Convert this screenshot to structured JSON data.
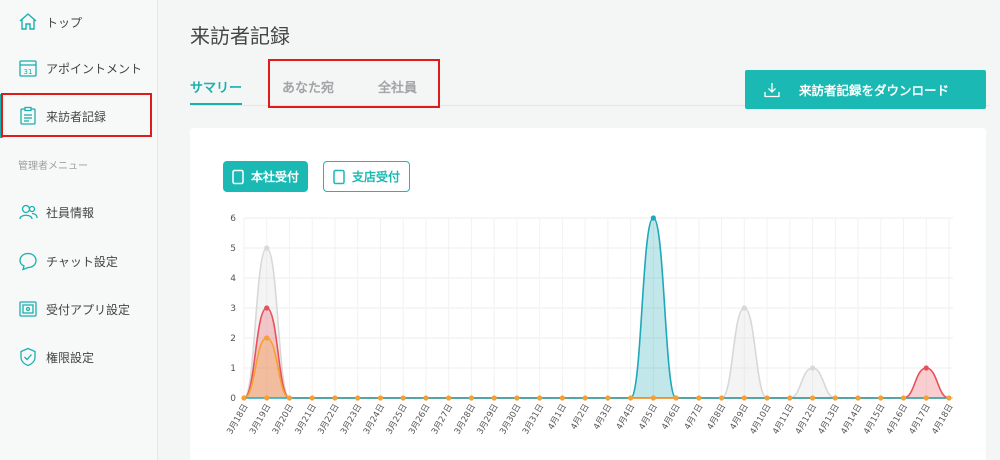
{
  "sidebar": {
    "items": [
      {
        "label": "トップ",
        "icon": "home-icon"
      },
      {
        "label": "アポイントメント",
        "icon": "calendar-icon",
        "icon_text": "31"
      },
      {
        "label": "来訪者記録",
        "icon": "clipboard-icon",
        "active": true
      },
      {
        "label": "社員情報",
        "icon": "users-icon"
      },
      {
        "label": "チャット設定",
        "icon": "chat-bubble-icon"
      },
      {
        "label": "受付アプリ設定",
        "icon": "tablet-icon"
      },
      {
        "label": "権限設定",
        "icon": "shield-check-icon"
      }
    ],
    "section_label": "管理者メニュー"
  },
  "main": {
    "title": "来訪者記録",
    "tabs": [
      {
        "label": "サマリー",
        "active": true
      },
      {
        "label": "あなた宛",
        "active": false
      },
      {
        "label": "全社員",
        "active": false
      }
    ],
    "download_button": {
      "label": "来訪者記録をダウンロード",
      "icon": "download-icon"
    },
    "filters": [
      {
        "label": "本社受付",
        "selected": true,
        "icon": "tablet-icon"
      },
      {
        "label": "支店受付",
        "selected": false,
        "icon": "tablet-icon"
      }
    ]
  },
  "colors": {
    "accent": "#1ab9b3",
    "highlight": "#e01b1b"
  },
  "chart_data": {
    "type": "area",
    "categories": [
      "3月18日",
      "3月19日",
      "3月20日",
      "3月21日",
      "3月22日",
      "3月23日",
      "3月24日",
      "3月25日",
      "3月26日",
      "3月27日",
      "3月28日",
      "3月29日",
      "3月30日",
      "3月31日",
      "4月1日",
      "4月2日",
      "4月3日",
      "4月4日",
      "4月5日",
      "4月6日",
      "4月7日",
      "4月8日",
      "4月9日",
      "4月10日",
      "4月11日",
      "4月12日",
      "4月13日",
      "4月14日",
      "4月15日",
      "4月16日",
      "4月17日",
      "4月18日"
    ],
    "ylim": [
      0,
      6
    ],
    "yticks": [
      0,
      1,
      2,
      3,
      4,
      5,
      6
    ],
    "grid": true,
    "series": [
      {
        "color": "#d8d8d8",
        "values": [
          0,
          5,
          0,
          0,
          0,
          0,
          0,
          0,
          0,
          0,
          0,
          0,
          0,
          0,
          0,
          0,
          0,
          0,
          0,
          0,
          0,
          0,
          3,
          0,
          0,
          1,
          0,
          0,
          0,
          0,
          0,
          0
        ]
      },
      {
        "color": "#e8505b",
        "values": [
          0,
          3,
          0,
          0,
          0,
          0,
          0,
          0,
          0,
          0,
          0,
          0,
          0,
          0,
          0,
          0,
          0,
          0,
          0,
          0,
          0,
          0,
          0,
          0,
          0,
          0,
          0,
          0,
          0,
          0,
          1,
          0
        ]
      },
      {
        "color": "#f5a030",
        "values": [
          0,
          2,
          0,
          0,
          0,
          0,
          0,
          0,
          0,
          0,
          0,
          0,
          0,
          0,
          0,
          0,
          0,
          0,
          0,
          0,
          0,
          0,
          0,
          0,
          0,
          0,
          0,
          0,
          0,
          0,
          0,
          0
        ]
      },
      {
        "color": "#1fa8b8",
        "values": [
          0,
          0,
          0,
          0,
          0,
          0,
          0,
          0,
          0,
          0,
          0,
          0,
          0,
          0,
          0,
          0,
          0,
          0,
          6,
          0,
          0,
          0,
          0,
          0,
          0,
          0,
          0,
          0,
          0,
          0,
          0,
          0
        ]
      }
    ]
  }
}
